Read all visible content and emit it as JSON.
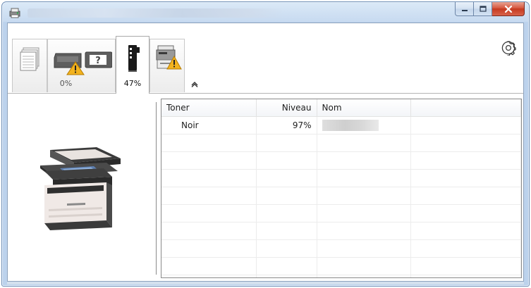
{
  "window": {
    "title": "",
    "controls": {
      "minimize": "—",
      "maximize": "□",
      "close": "✕"
    }
  },
  "tabs": [
    {
      "id": "jobs",
      "icon": "document-stack-icon",
      "level": ""
    },
    {
      "id": "paper",
      "icon": "paper-tray-warning-icon",
      "level": "0%"
    },
    {
      "id": "toner",
      "icon": "toner-cartridge-icon",
      "level": "47%",
      "active": true
    },
    {
      "id": "device",
      "icon": "printer-warning-icon",
      "level": ""
    }
  ],
  "toolbar": {
    "settings_icon": "gear-icon",
    "collapse_icon": "chevron-up-icon"
  },
  "table": {
    "headers": [
      "Toner",
      "Niveau",
      "Nom",
      ""
    ],
    "rows": [
      [
        "Noir",
        "97%",
        "",
        ""
      ]
    ],
    "empty_rows": 9
  },
  "device_image": "multifunction-printer-image",
  "colors": {
    "accent": "#3c7fd6",
    "warning": "#f3b31e",
    "close_button": "#c53a20",
    "frame": "#bcd2ec"
  }
}
